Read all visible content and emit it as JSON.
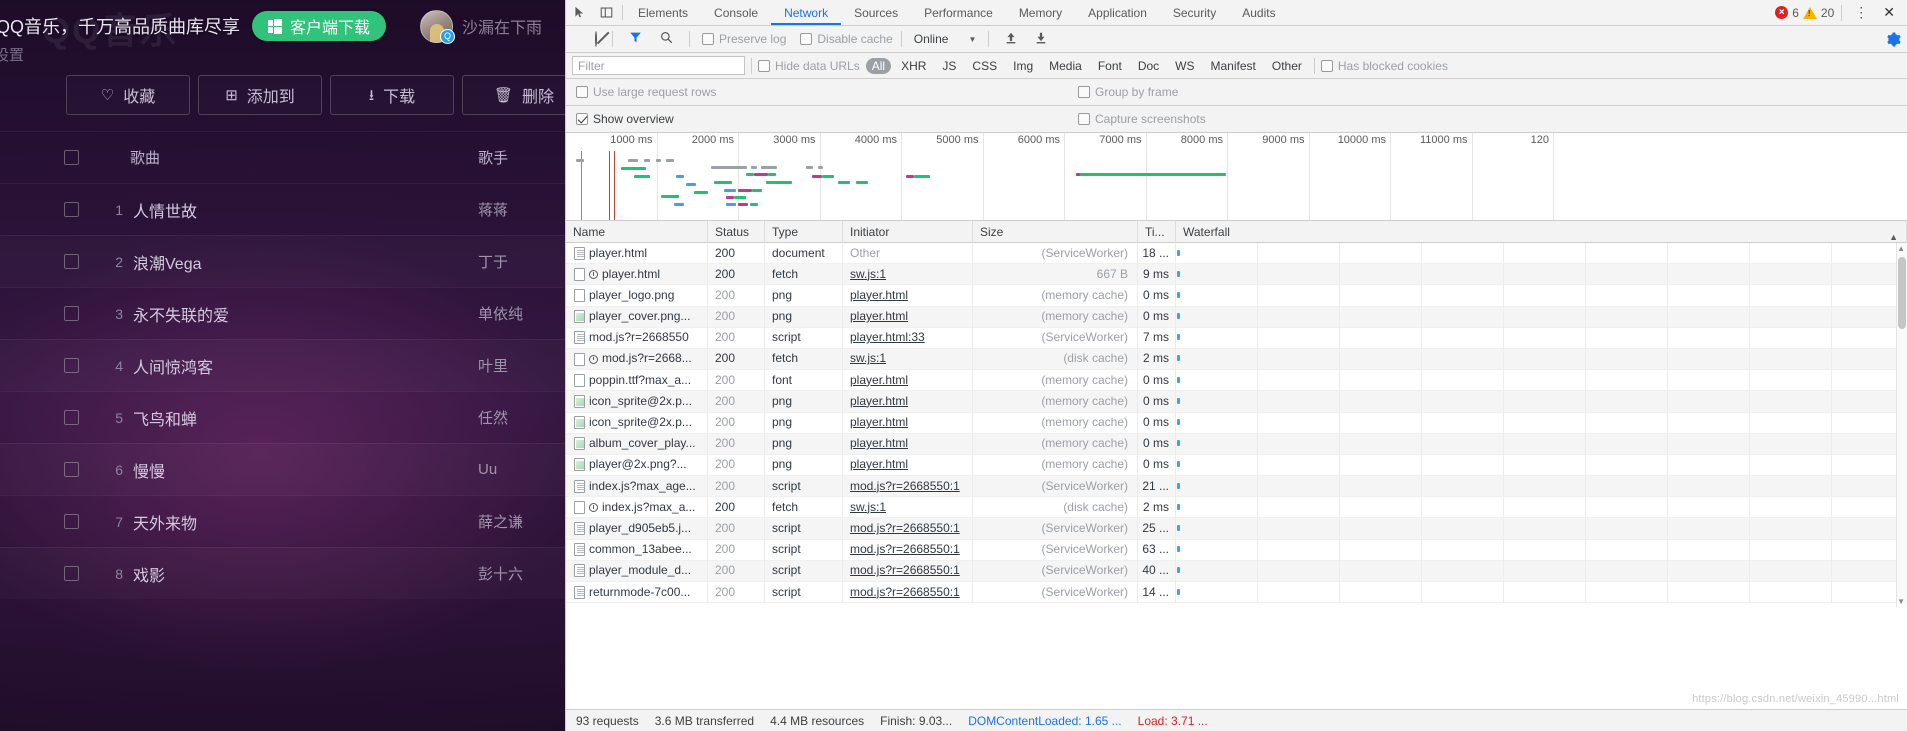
{
  "qq": {
    "watermark": "QQ音乐",
    "slogan": "QQ音乐，千万高品质曲库尽享",
    "download_button": "客户端下载",
    "username": "沙漏在下雨",
    "settings": "设置",
    "actions": [
      {
        "icon": "heart-icon",
        "glyph": "♡",
        "label": "收藏"
      },
      {
        "icon": "add-to-icon",
        "glyph": "⊞",
        "label": "添加到"
      },
      {
        "icon": "download-icon",
        "glyph": "⭳",
        "label": "下载"
      },
      {
        "icon": "trash-icon",
        "glyph": "🗑",
        "label": "删除"
      }
    ],
    "list_header": {
      "song": "歌曲",
      "artist": "歌手"
    },
    "songs": [
      {
        "index": "1",
        "title": "人情世故",
        "artist": "蒋蒋"
      },
      {
        "index": "2",
        "title": "浪潮Vega",
        "artist": "丁于"
      },
      {
        "index": "3",
        "title": "永不失联的爱",
        "artist": "单依纯"
      },
      {
        "index": "4",
        "title": "人间惊鸿客",
        "artist": "叶里"
      },
      {
        "index": "5",
        "title": "飞鸟和蝉",
        "artist": "任然"
      },
      {
        "index": "6",
        "title": "慢慢",
        "artist": "Uu"
      },
      {
        "index": "7",
        "title": "天外来物",
        "artist": "薛之谦"
      },
      {
        "index": "8",
        "title": "戏影",
        "artist": "彭十六"
      }
    ]
  },
  "devtools": {
    "tabs": [
      {
        "label": "Elements",
        "active": false
      },
      {
        "label": "Console",
        "active": false
      },
      {
        "label": "Network",
        "active": true
      },
      {
        "label": "Sources",
        "active": false
      },
      {
        "label": "Performance",
        "active": false
      },
      {
        "label": "Memory",
        "active": false
      },
      {
        "label": "Application",
        "active": false
      },
      {
        "label": "Security",
        "active": false
      },
      {
        "label": "Audits",
        "active": false
      }
    ],
    "error_count": "6",
    "warning_count": "20",
    "toolbar": {
      "preserve_log": "Preserve log",
      "disable_cache": "Disable cache",
      "throttling": "Online"
    },
    "filterbar": {
      "filter_placeholder": "Filter",
      "hide_data_urls": "Hide data URLs",
      "types": [
        "All",
        "XHR",
        "JS",
        "CSS",
        "Img",
        "Media",
        "Font",
        "Doc",
        "WS",
        "Manifest",
        "Other"
      ],
      "selected_type": "All",
      "has_blocked_cookies": "Has blocked cookies"
    },
    "options": {
      "use_large_request_rows": "Use large request rows",
      "group_by_frame": "Group by frame",
      "show_overview": "Show overview",
      "capture_screenshots": "Capture screenshots"
    },
    "overview_ticks": [
      "1000 ms",
      "2000 ms",
      "3000 ms",
      "4000 ms",
      "5000 ms",
      "6000 ms",
      "7000 ms",
      "8000 ms",
      "9000 ms",
      "10000 ms",
      "11000 ms",
      "120"
    ],
    "columns": [
      "Name",
      "Status",
      "Type",
      "Initiator",
      "Size",
      "Ti...",
      "Waterfall"
    ],
    "requests": [
      {
        "name": "player.html",
        "icon": "document-icon",
        "sw": false,
        "status": "200",
        "type": "document",
        "initiator": "Other",
        "initiator_link": false,
        "size": "(ServiceWorker)",
        "time": "18 ...",
        "dim_status": false
      },
      {
        "name": "player.html",
        "icon": "plain-icon",
        "sw": true,
        "status": "200",
        "type": "fetch",
        "initiator": "sw.js:1",
        "initiator_link": true,
        "size": "667 B",
        "time": "9 ms",
        "dim_status": false
      },
      {
        "name": "player_logo.png",
        "icon": "plain-icon",
        "sw": false,
        "status": "200",
        "type": "png",
        "initiator": "player.html",
        "initiator_link": true,
        "size": "(memory cache)",
        "time": "0 ms",
        "dim_status": true
      },
      {
        "name": "player_cover.png...",
        "icon": "image-icon",
        "sw": false,
        "status": "200",
        "type": "png",
        "initiator": "player.html",
        "initiator_link": true,
        "size": "(memory cache)",
        "time": "0 ms",
        "dim_status": true
      },
      {
        "name": "mod.js?r=2668550",
        "icon": "document-icon",
        "sw": false,
        "status": "200",
        "type": "script",
        "initiator": "player.html:33",
        "initiator_link": true,
        "size": "(ServiceWorker)",
        "time": "7 ms",
        "dim_status": true
      },
      {
        "name": "mod.js?r=2668...",
        "icon": "plain-icon",
        "sw": true,
        "status": "200",
        "type": "fetch",
        "initiator": "sw.js:1",
        "initiator_link": true,
        "size": "(disk cache)",
        "time": "2 ms",
        "dim_status": false
      },
      {
        "name": "poppin.ttf?max_a...",
        "icon": "plain-icon",
        "sw": false,
        "status": "200",
        "type": "font",
        "initiator": "player.html",
        "initiator_link": true,
        "size": "(memory cache)",
        "time": "0 ms",
        "dim_status": true
      },
      {
        "name": "icon_sprite@2x.p...",
        "icon": "image-icon",
        "sw": false,
        "status": "200",
        "type": "png",
        "initiator": "player.html",
        "initiator_link": true,
        "size": "(memory cache)",
        "time": "0 ms",
        "dim_status": true
      },
      {
        "name": "icon_sprite@2x.p...",
        "icon": "image-icon",
        "sw": false,
        "status": "200",
        "type": "png",
        "initiator": "player.html",
        "initiator_link": true,
        "size": "(memory cache)",
        "time": "0 ms",
        "dim_status": true
      },
      {
        "name": "album_cover_play...",
        "icon": "image-icon",
        "sw": false,
        "status": "200",
        "type": "png",
        "initiator": "player.html",
        "initiator_link": true,
        "size": "(memory cache)",
        "time": "0 ms",
        "dim_status": true
      },
      {
        "name": "player@2x.png?...",
        "icon": "image-icon",
        "sw": false,
        "status": "200",
        "type": "png",
        "initiator": "player.html",
        "initiator_link": true,
        "size": "(memory cache)",
        "time": "0 ms",
        "dim_status": true
      },
      {
        "name": "index.js?max_age...",
        "icon": "document-icon",
        "sw": false,
        "status": "200",
        "type": "script",
        "initiator": "mod.js?r=2668550:1",
        "initiator_link": true,
        "size": "(ServiceWorker)",
        "time": "21 ...",
        "dim_status": true
      },
      {
        "name": "index.js?max_a...",
        "icon": "plain-icon",
        "sw": true,
        "status": "200",
        "type": "fetch",
        "initiator": "sw.js:1",
        "initiator_link": true,
        "size": "(disk cache)",
        "time": "2 ms",
        "dim_status": false
      },
      {
        "name": "player_d905eb5.j...",
        "icon": "document-icon",
        "sw": false,
        "status": "200",
        "type": "script",
        "initiator": "mod.js?r=2668550:1",
        "initiator_link": true,
        "size": "(ServiceWorker)",
        "time": "25 ...",
        "dim_status": true
      },
      {
        "name": "common_13abee...",
        "icon": "document-icon",
        "sw": false,
        "status": "200",
        "type": "script",
        "initiator": "mod.js?r=2668550:1",
        "initiator_link": true,
        "size": "(ServiceWorker)",
        "time": "63 ...",
        "dim_status": true
      },
      {
        "name": "player_module_d...",
        "icon": "document-icon",
        "sw": false,
        "status": "200",
        "type": "script",
        "initiator": "mod.js?r=2668550:1",
        "initiator_link": true,
        "size": "(ServiceWorker)",
        "time": "40 ...",
        "dim_status": true
      },
      {
        "name": "returnmode-7c00...",
        "icon": "document-icon",
        "sw": false,
        "status": "200",
        "type": "script",
        "initiator": "mod.js?r=2668550:1",
        "initiator_link": true,
        "size": "(ServiceWorker)",
        "time": "14 ...",
        "dim_status": true
      }
    ],
    "status_bar": {
      "requests": "93 requests",
      "transferred": "3.6 MB transferred",
      "resources": "4.4 MB resources",
      "finish": "Finish: 9.03...",
      "domcontentloaded_label": "DOMContentLoaded:",
      "domcontentloaded_value": "1.65 ...",
      "load_label": "Load:",
      "load_value": "3.71 ..."
    },
    "watermark_url": "https://blog.csdn.net/weixin_45990...html"
  }
}
